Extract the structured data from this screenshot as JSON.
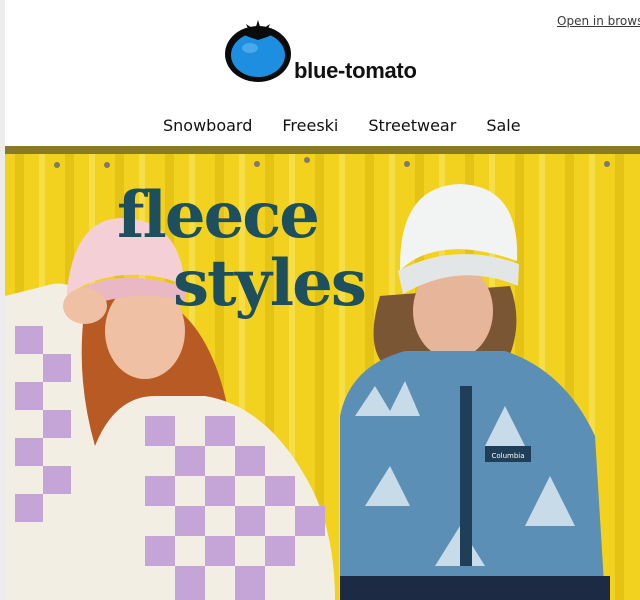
{
  "header": {
    "open_in_browser": "Open in browse",
    "logo_text": "blue-tomato"
  },
  "nav": {
    "items": [
      {
        "label": "Snowboard"
      },
      {
        "label": "Freeski"
      },
      {
        "label": "Streetwear"
      },
      {
        "label": "Sale"
      }
    ]
  },
  "hero": {
    "headline_line1": "fleece",
    "headline_line2": "styles",
    "brand_tag": "Columbia"
  },
  "colors": {
    "headline": "#1d4f5f",
    "background_wall": "#f2d21e",
    "logo_blue": "#1e8fe0"
  }
}
